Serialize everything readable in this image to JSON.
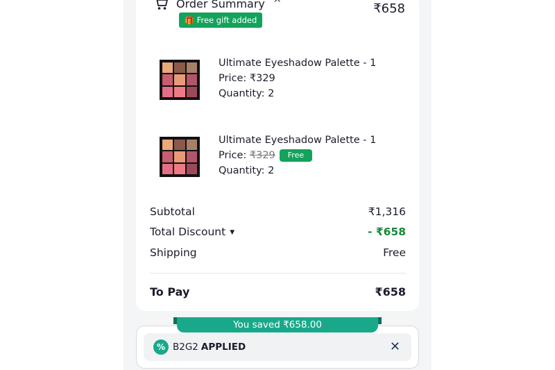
{
  "order_summary": {
    "title": "Order Summary",
    "total": "₹658",
    "gift_badge": "Free gift added"
  },
  "items": [
    {
      "name": "Ultimate Eyeshadow Palette - 1",
      "price_label": "Price: ",
      "price": "₹329",
      "free_label": "",
      "quantity": "Quantity: 2"
    },
    {
      "name": "Ultimate Eyeshadow Palette - 1",
      "price_label": "Price: ",
      "price": "₹329",
      "free_label": "Free",
      "quantity": "Quantity: 2"
    }
  ],
  "summary": {
    "subtotal_label": "Subtotal",
    "subtotal_value": "₹1,316",
    "discount_label": "Total Discount",
    "discount_value": "- ₹658",
    "shipping_label": "Shipping",
    "shipping_value": "Free",
    "topay_label": "To Pay",
    "topay_value": "₹658"
  },
  "coupon": {
    "saved_text": "You saved ₹658.00",
    "code": "B2G2",
    "status": "APPLIED"
  },
  "colors": {
    "accent_green": "#13a35b",
    "teal": "#19a98a",
    "discount_green": "#178a36"
  },
  "icons": {
    "cart": "cart-icon",
    "chevron": "chevron-up-icon",
    "gift": "gift-icon",
    "coupon": "percent-badge-icon",
    "remove": "close-icon"
  }
}
